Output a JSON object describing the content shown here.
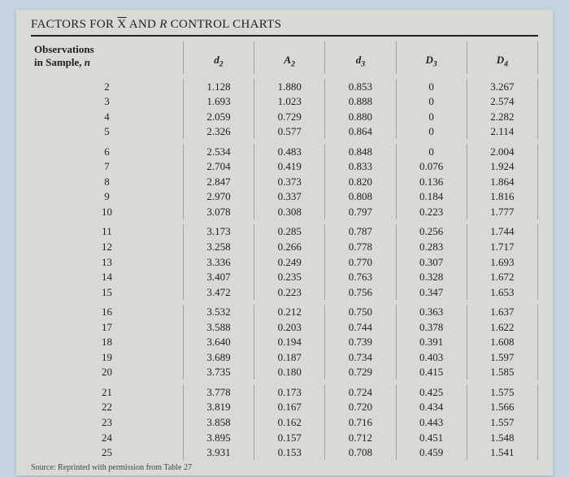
{
  "title_prefix": "FACTORS FOR ",
  "title_x": "X",
  "title_mid": " AND ",
  "title_r": "R",
  "title_suffix": " CONTROL CHARTS",
  "header": {
    "obs_line1": "Observations",
    "obs_line2": "in Sample, ",
    "obs_n": "n",
    "d2": "d",
    "d2_sub": "2",
    "A2": "A",
    "A2_sub": "2",
    "d3": "d",
    "d3_sub": "3",
    "D3": "D",
    "D3_sub": "3",
    "D4": "D",
    "D4_sub": "4"
  },
  "chart_data": {
    "type": "table",
    "columns": [
      "n",
      "d2",
      "A2",
      "d3",
      "D3",
      "D4"
    ],
    "groups": [
      [
        {
          "n": "2",
          "d2": "1.128",
          "A2": "1.880",
          "d3": "0.853",
          "D3": "0",
          "D4": "3.267"
        },
        {
          "n": "3",
          "d2": "1.693",
          "A2": "1.023",
          "d3": "0.888",
          "D3": "0",
          "D4": "2.574"
        },
        {
          "n": "4",
          "d2": "2.059",
          "A2": "0.729",
          "d3": "0.880",
          "D3": "0",
          "D4": "2.282"
        },
        {
          "n": "5",
          "d2": "2.326",
          "A2": "0.577",
          "d3": "0.864",
          "D3": "0",
          "D4": "2.114"
        }
      ],
      [
        {
          "n": "6",
          "d2": "2.534",
          "A2": "0.483",
          "d3": "0.848",
          "D3": "0",
          "D4": "2.004"
        },
        {
          "n": "7",
          "d2": "2.704",
          "A2": "0.419",
          "d3": "0.833",
          "D3": "0.076",
          "D4": "1.924"
        },
        {
          "n": "8",
          "d2": "2.847",
          "A2": "0.373",
          "d3": "0.820",
          "D3": "0.136",
          "D4": "1.864"
        },
        {
          "n": "9",
          "d2": "2.970",
          "A2": "0.337",
          "d3": "0.808",
          "D3": "0.184",
          "D4": "1.816"
        },
        {
          "n": "10",
          "d2": "3.078",
          "A2": "0.308",
          "d3": "0.797",
          "D3": "0.223",
          "D4": "1.777"
        }
      ],
      [
        {
          "n": "11",
          "d2": "3.173",
          "A2": "0.285",
          "d3": "0.787",
          "D3": "0.256",
          "D4": "1.744"
        },
        {
          "n": "12",
          "d2": "3.258",
          "A2": "0.266",
          "d3": "0.778",
          "D3": "0.283",
          "D4": "1.717"
        },
        {
          "n": "13",
          "d2": "3.336",
          "A2": "0.249",
          "d3": "0.770",
          "D3": "0.307",
          "D4": "1.693"
        },
        {
          "n": "14",
          "d2": "3.407",
          "A2": "0.235",
          "d3": "0.763",
          "D3": "0.328",
          "D4": "1.672"
        },
        {
          "n": "15",
          "d2": "3.472",
          "A2": "0.223",
          "d3": "0.756",
          "D3": "0.347",
          "D4": "1.653"
        }
      ],
      [
        {
          "n": "16",
          "d2": "3.532",
          "A2": "0.212",
          "d3": "0.750",
          "D3": "0.363",
          "D4": "1.637"
        },
        {
          "n": "17",
          "d2": "3.588",
          "A2": "0.203",
          "d3": "0.744",
          "D3": "0.378",
          "D4": "1.622"
        },
        {
          "n": "18",
          "d2": "3.640",
          "A2": "0.194",
          "d3": "0.739",
          "D3": "0.391",
          "D4": "1.608"
        },
        {
          "n": "19",
          "d2": "3.689",
          "A2": "0.187",
          "d3": "0.734",
          "D3": "0.403",
          "D4": "1.597"
        },
        {
          "n": "20",
          "d2": "3.735",
          "A2": "0.180",
          "d3": "0.729",
          "D3": "0.415",
          "D4": "1.585"
        }
      ],
      [
        {
          "n": "21",
          "d2": "3.778",
          "A2": "0.173",
          "d3": "0.724",
          "D3": "0.425",
          "D4": "1.575"
        },
        {
          "n": "22",
          "d2": "3.819",
          "A2": "0.167",
          "d3": "0.720",
          "D3": "0.434",
          "D4": "1.566"
        },
        {
          "n": "23",
          "d2": "3.858",
          "A2": "0.162",
          "d3": "0.716",
          "D3": "0.443",
          "D4": "1.557"
        },
        {
          "n": "24",
          "d2": "3.895",
          "A2": "0.157",
          "d3": "0.712",
          "D3": "0.451",
          "D4": "1.548"
        },
        {
          "n": "25",
          "d2": "3.931",
          "A2": "0.153",
          "d3": "0.708",
          "D3": "0.459",
          "D4": "1.541"
        }
      ]
    ]
  },
  "source_text": "Source: Reprinted with permission from Table 27"
}
